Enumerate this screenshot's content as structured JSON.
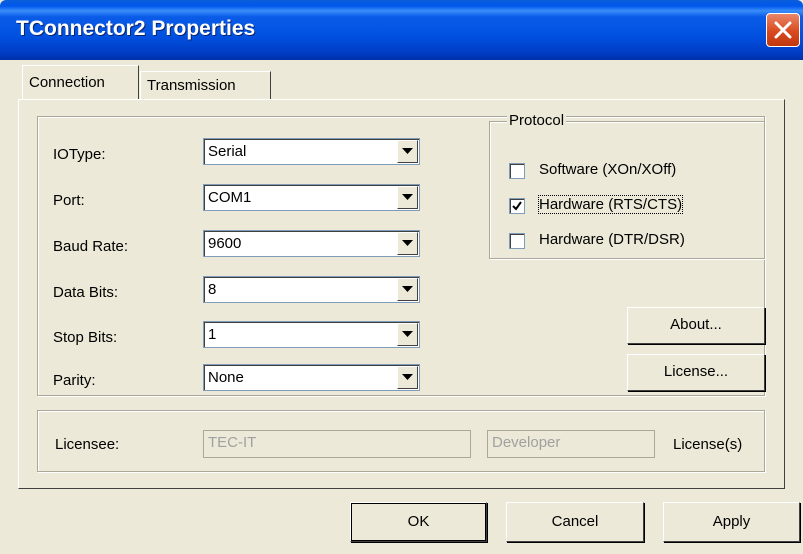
{
  "window": {
    "title": "TConnector2 Properties"
  },
  "tabs": [
    {
      "label": "Connection",
      "active": true
    },
    {
      "label": "Transmission",
      "active": false
    }
  ],
  "fields": [
    {
      "label": "IOType:",
      "value": "Serial"
    },
    {
      "label": "Port:",
      "value": "COM1"
    },
    {
      "label": "Baud Rate:",
      "value": "9600"
    },
    {
      "label": "Data Bits:",
      "value": "8"
    },
    {
      "label": "Stop Bits:",
      "value": "1"
    },
    {
      "label": "Parity:",
      "value": "None"
    }
  ],
  "protocol": {
    "legend": "Protocol",
    "options": [
      {
        "label": "Software (XOn/XOff)",
        "checked": false
      },
      {
        "label": "Hardware (RTS/CTS)",
        "checked": true
      },
      {
        "label": "Hardware (DTR/DSR)",
        "checked": false
      }
    ]
  },
  "buttons": {
    "about": "About...",
    "license": "License...",
    "ok": "OK",
    "cancel": "Cancel",
    "apply": "Apply"
  },
  "licensee": {
    "label": "Licensee:",
    "name": "TEC-IT",
    "type": "Developer",
    "suffix": "License(s)"
  },
  "colors": {
    "titlebar": "#0058ee",
    "close": "#d94a1e",
    "face": "#ece9d8"
  }
}
